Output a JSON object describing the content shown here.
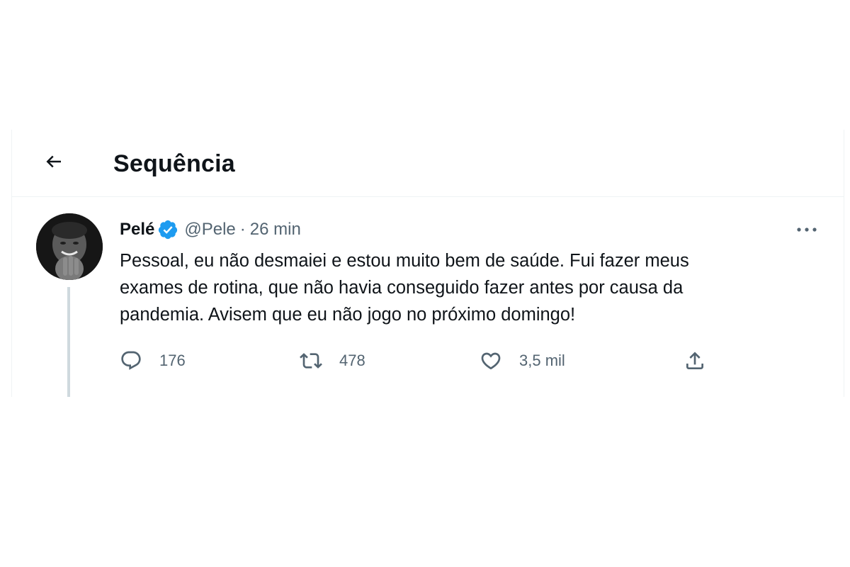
{
  "header": {
    "title": "Sequência"
  },
  "tweet": {
    "author_name": "Pelé",
    "handle": "@Pele",
    "separator": "·",
    "time": "26 min",
    "text": "Pessoal, eu não desmaiei e estou muito bem de saúde. Fui fazer meus\nexames de rotina, que não havia conseguido fazer antes por causa da\npandemia. Avisem que eu não jogo no próximo domingo!",
    "replies": "176",
    "retweets": "478",
    "likes": "3,5 mil"
  },
  "icons": {
    "back": "arrow-left-icon",
    "verified": "verified-badge-icon",
    "more": "more-horizontal-icon",
    "reply": "reply-bubble-icon",
    "retweet": "retweet-icon",
    "like": "heart-icon",
    "share": "share-icon"
  },
  "colors": {
    "text": "#0f1419",
    "secondary": "#536471",
    "verified": "#1d9bf0",
    "divider": "#eff3f4"
  }
}
